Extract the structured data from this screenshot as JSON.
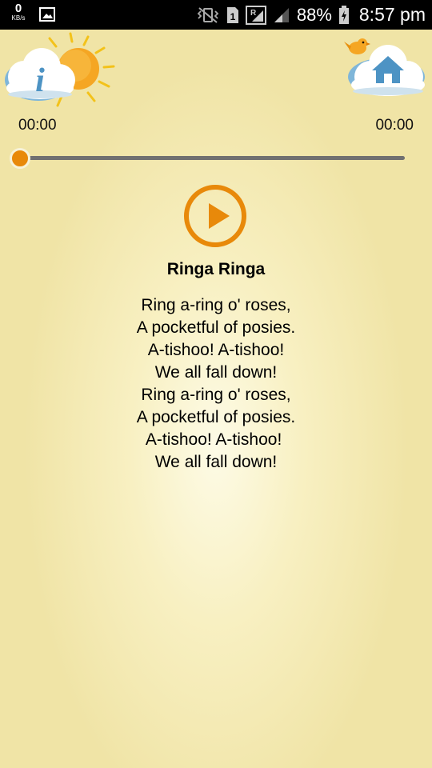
{
  "status_bar": {
    "net_speed": "0",
    "net_unit": "KB/s",
    "sim_badge": "1",
    "network_badge": "R",
    "battery_pct": "88%",
    "time": "8:57 pm"
  },
  "header": {
    "info_icon": "info-cloud-icon",
    "home_icon": "home-cloud-icon"
  },
  "player": {
    "current_time": "00:00",
    "total_time": "00:00",
    "progress": 0,
    "accent_color": "#e8890a"
  },
  "song": {
    "title": "Ringa Ringa",
    "lyrics": [
      "Ring a-ring o' roses,",
      "A pocketful of posies.",
      "A-tishoo! A-tishoo!",
      "We all fall down!",
      "Ring a-ring o' roses,",
      "A pocketful of posies.",
      "A-tishoo! A-tishoo! ",
      "We all fall down!"
    ]
  }
}
